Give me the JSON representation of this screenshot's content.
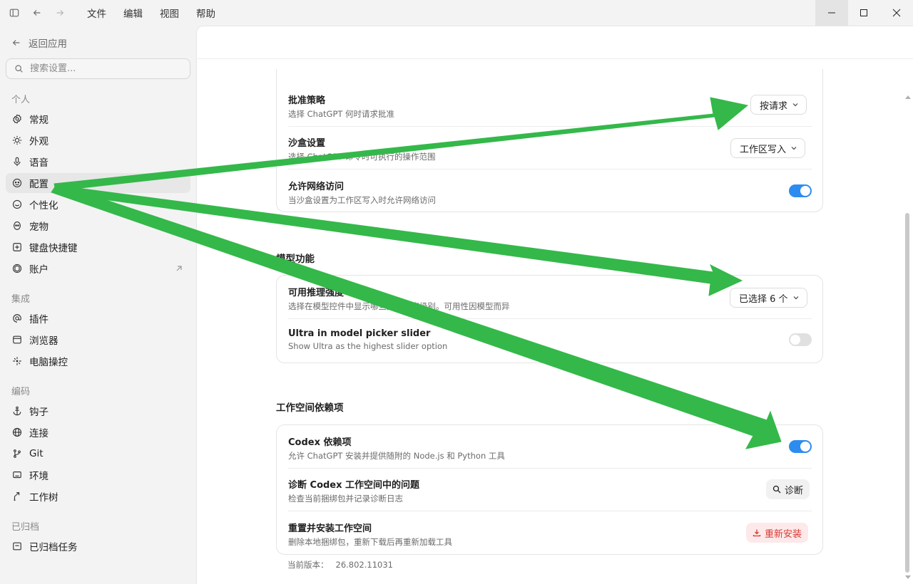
{
  "titlebar": {
    "menu": [
      "文件",
      "编辑",
      "视图",
      "帮助"
    ]
  },
  "sidebar": {
    "back_label": "返回应用",
    "search_placeholder": "搜索设置...",
    "sections": [
      {
        "title": "个人",
        "items": [
          {
            "label": "常规",
            "icon": "gear-icon"
          },
          {
            "label": "外观",
            "icon": "sun-icon"
          },
          {
            "label": "语音",
            "icon": "microphone-icon"
          },
          {
            "label": "配置",
            "icon": "config-icon",
            "active": true
          },
          {
            "label": "个性化",
            "icon": "personalize-icon"
          },
          {
            "label": "宠物",
            "icon": "pet-icon"
          },
          {
            "label": "键盘快捷键",
            "icon": "keyboard-icon"
          },
          {
            "label": "账户",
            "icon": "account-icon",
            "external": true
          }
        ]
      },
      {
        "title": "集成",
        "items": [
          {
            "label": "插件",
            "icon": "at-icon"
          },
          {
            "label": "浏览器",
            "icon": "browser-icon"
          },
          {
            "label": "电脑操控",
            "icon": "cursor-icon"
          }
        ]
      },
      {
        "title": "编码",
        "items": [
          {
            "label": "钩子",
            "icon": "anchor-icon"
          },
          {
            "label": "连接",
            "icon": "globe-icon"
          },
          {
            "label": "Git",
            "icon": "git-branch-icon"
          },
          {
            "label": "环境",
            "icon": "laptop-icon"
          },
          {
            "label": "工作树",
            "icon": "worktree-icon"
          }
        ]
      },
      {
        "title": "已归档",
        "items": [
          {
            "label": "已归档任务",
            "icon": "archive-icon"
          }
        ]
      }
    ]
  },
  "main": {
    "approval": {
      "policy": {
        "title": "批准策略",
        "desc": "选择 ChatGPT 何时请求批准",
        "value": "按请求"
      },
      "sandbox": {
        "title": "沙盒设置",
        "desc": "选择 ChatGPT 命令时可执行的操作范围",
        "value": "工作区写入"
      },
      "network": {
        "title": "允许网络访问",
        "desc": "当沙盒设置为工作区写入时允许网络访问",
        "enabled": true
      }
    },
    "model": {
      "title": "模型功能",
      "reasoning": {
        "title": "可用推理强度",
        "desc": "选择在模型控件中显示哪些推理强度级别。可用性因模型而异",
        "value": "已选择 6 个"
      },
      "ultra": {
        "title": "Ultra in model picker slider",
        "desc": "Show Ultra as the highest slider option",
        "enabled": false
      }
    },
    "workspace": {
      "title": "工作空间依赖项",
      "codex": {
        "title": "Codex 依赖项",
        "desc": "允许 ChatGPT 安装并提供随附的 Node.js 和 Python 工具",
        "enabled": true
      },
      "diagnose": {
        "title": "诊断 Codex 工作空间中的问题",
        "desc": "检查当前捆绑包并记录诊断日志",
        "button": "诊断"
      },
      "reset": {
        "title": "重置并安装工作空间",
        "desc": "删除本地捆绑包，重新下载后再重新加载工具",
        "button": "重新安装"
      }
    },
    "version_label": "当前版本：",
    "version_value": "26.802.11031"
  },
  "colors": {
    "accent": "#2d8cf0",
    "danger": "#d93a32",
    "annotation_arrow": "#34b84a"
  }
}
